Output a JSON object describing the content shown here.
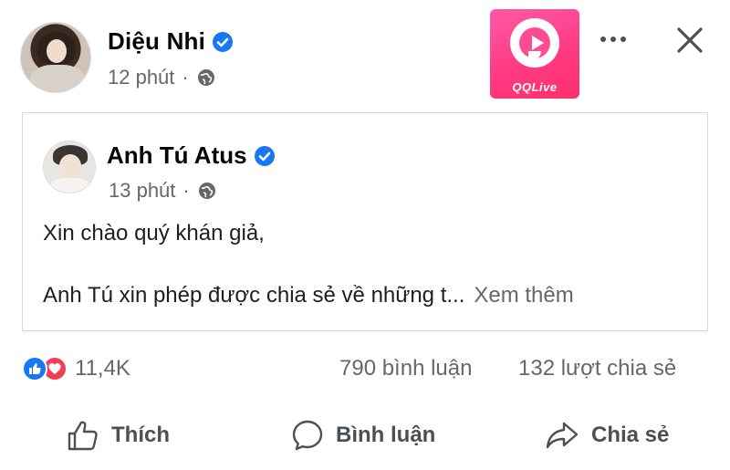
{
  "post": {
    "author": "Diệu Nhi",
    "time": "12 phút",
    "separator": "·",
    "privacy_icon": "globe-icon"
  },
  "brand": {
    "logo_text": "QQLive",
    "colors": {
      "primary": "#ff3b84"
    }
  },
  "shared_post": {
    "author": "Anh Tú Atus",
    "time": "13 phút",
    "separator": "·",
    "line1": "Xin chào quý khán giả,",
    "line2": "Anh Tú xin phép được chia sẻ về những t...",
    "see_more": "Xem thêm"
  },
  "stats": {
    "reactions_count": "11,4K",
    "comments": "790 bình luận",
    "shares": "132 lượt chia sẻ"
  },
  "actions": {
    "like": "Thích",
    "comment": "Bình luận",
    "share": "Chia sẻ"
  },
  "colors": {
    "verified": "#1877f2",
    "like": "#1877f2",
    "love": "#f33e58",
    "muted_text": "#65676b"
  }
}
